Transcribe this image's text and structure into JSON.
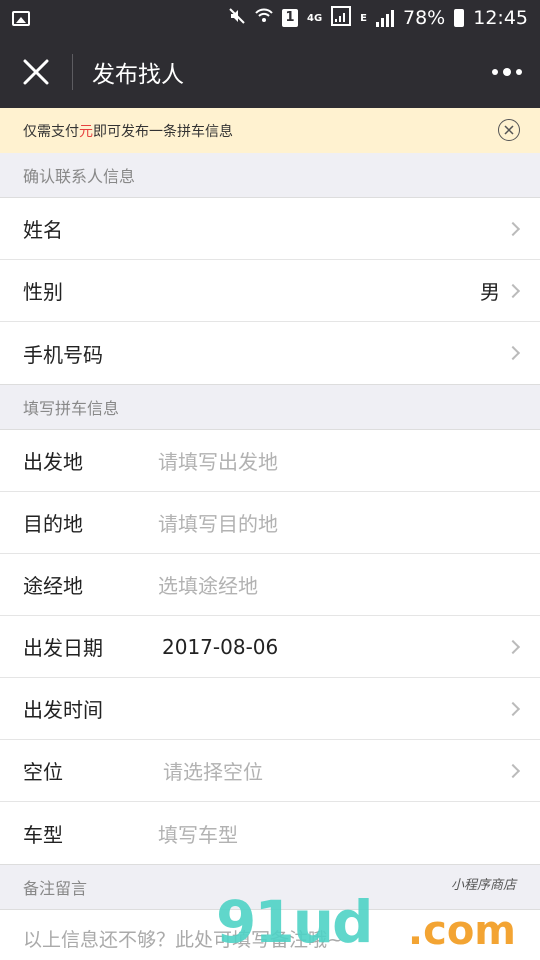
{
  "status_bar": {
    "battery": "78%",
    "time": "12:45",
    "sim_label": "1",
    "network": "4G",
    "network2": "E"
  },
  "nav": {
    "title": "发布找人"
  },
  "notice": {
    "prefix": "仅需支付",
    "highlight": "元",
    "suffix": "即可发布一条拼车信息",
    "highlight_color": "#e64340"
  },
  "contact_section": {
    "header": "确认联系人信息",
    "rows": [
      {
        "label": "姓名",
        "value": ""
      },
      {
        "label": "性别",
        "value": "男"
      },
      {
        "label": "手机号码",
        "value": ""
      }
    ]
  },
  "trip_section": {
    "header": "填写拼车信息",
    "rows": [
      {
        "label": "出发地",
        "placeholder": "请填写出发地"
      },
      {
        "label": "目的地",
        "placeholder": "请填写目的地"
      },
      {
        "label": "途经地",
        "placeholder": "选填途经地"
      },
      {
        "label": "出发日期",
        "value": "2017-08-06"
      },
      {
        "label": "出发时间",
        "value": ""
      },
      {
        "label": "空位",
        "placeholder": "请选择空位"
      },
      {
        "label": "车型",
        "placeholder": "填写车型"
      }
    ]
  },
  "remark_section": {
    "header": "备注留言",
    "placeholder": "以上信息还不够？此处可填写备注哦~"
  },
  "watermark": {
    "main": "91ud",
    "suffix": ".com",
    "tagline": "小程序商店"
  },
  "colors": {
    "nav_bg": "#2e2d32",
    "notice_bg": "#fff2d0",
    "page_bg": "#efeff4"
  }
}
